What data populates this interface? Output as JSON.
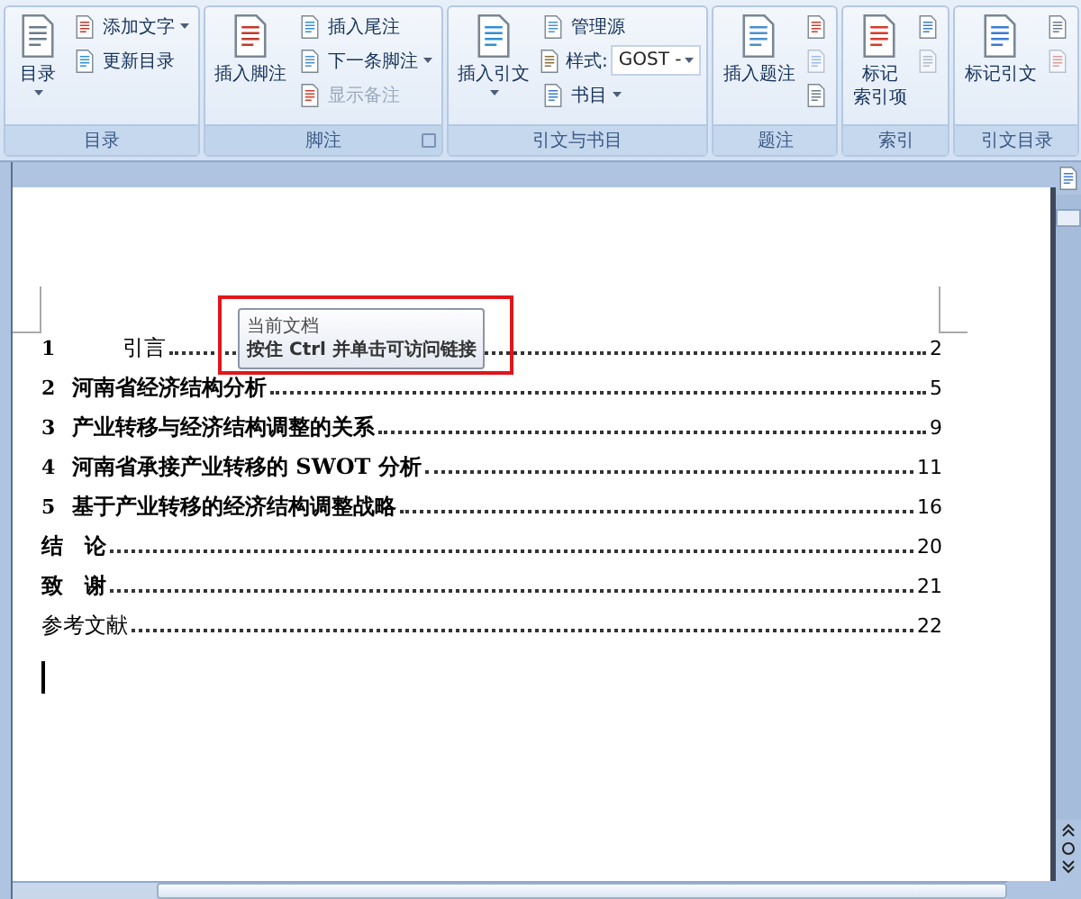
{
  "ribbon": {
    "groups": [
      {
        "label": "目录",
        "has_launcher": false,
        "buttons": [
          {
            "kind": "large",
            "lines": [
              "目录"
            ],
            "dropdown": true
          },
          {
            "kind": "small",
            "label": "添加文字",
            "dropdown": true,
            "disabled": false
          },
          {
            "kind": "small",
            "label": "更新目录",
            "dropdown": false,
            "disabled": false
          }
        ]
      },
      {
        "label": "脚注",
        "has_launcher": true,
        "buttons": [
          {
            "kind": "large",
            "lines": [
              "插入脚注"
            ],
            "dropdown": false
          },
          {
            "kind": "small",
            "label": "插入尾注",
            "dropdown": false,
            "disabled": false
          },
          {
            "kind": "small",
            "label": "下一条脚注",
            "dropdown": true,
            "disabled": false
          },
          {
            "kind": "small",
            "label": "显示备注",
            "dropdown": false,
            "disabled": true
          }
        ]
      },
      {
        "label": "引文与书目",
        "has_launcher": false,
        "buttons": [
          {
            "kind": "large",
            "lines": [
              "插入引文"
            ],
            "dropdown": true
          },
          {
            "kind": "small",
            "label": "管理源",
            "dropdown": false,
            "disabled": false
          },
          {
            "kind": "select",
            "label": "样式:",
            "value": "GOST -"
          },
          {
            "kind": "small",
            "label": "书目",
            "dropdown": true,
            "disabled": false
          }
        ]
      },
      {
        "label": "题注",
        "has_launcher": false,
        "buttons": [
          {
            "kind": "large",
            "lines": [
              "插入题注"
            ],
            "dropdown": false
          },
          {
            "kind": "icon",
            "disabled": false
          },
          {
            "kind": "icon",
            "disabled": true
          },
          {
            "kind": "icon",
            "disabled": false
          }
        ]
      },
      {
        "label": "索引",
        "has_launcher": false,
        "buttons": [
          {
            "kind": "large",
            "lines": [
              "标记",
              "索引项"
            ],
            "dropdown": false
          },
          {
            "kind": "icon",
            "disabled": false
          },
          {
            "kind": "icon",
            "disabled": true
          }
        ]
      },
      {
        "label": "引文目录",
        "has_launcher": false,
        "buttons": [
          {
            "kind": "large",
            "lines": [
              "标记引文"
            ],
            "dropdown": false
          },
          {
            "kind": "icon",
            "disabled": false
          },
          {
            "kind": "icon",
            "disabled": true
          }
        ]
      }
    ]
  },
  "document": {
    "toc": [
      {
        "number": "1",
        "title": "引言",
        "page": "2",
        "bold": false,
        "title_indented": true
      },
      {
        "number": "2",
        "title": "河南省经济结构分析",
        "page": "5",
        "bold": true,
        "title_indented": false
      },
      {
        "number": "3",
        "title": "产业转移与经济结构调整的关系",
        "page": "9",
        "bold": true,
        "title_indented": false
      },
      {
        "number": "4",
        "title": "河南省承接产业转移的 SWOT 分析",
        "page": "11",
        "bold": true,
        "title_indented": false
      },
      {
        "number": "5",
        "title": "基于产业转移的经济结构调整战略",
        "page": "16",
        "bold": true,
        "title_indented": false
      },
      {
        "title": "结　论",
        "page": "20",
        "bold": true
      },
      {
        "title": "致　谢",
        "page": "21",
        "bold": true
      },
      {
        "title": "参考文献",
        "page": "22",
        "bold": false
      }
    ],
    "tooltip": {
      "title": "当前文档",
      "text": "按住 Ctrl 并单击可访问链接",
      "highlighted": true
    }
  }
}
